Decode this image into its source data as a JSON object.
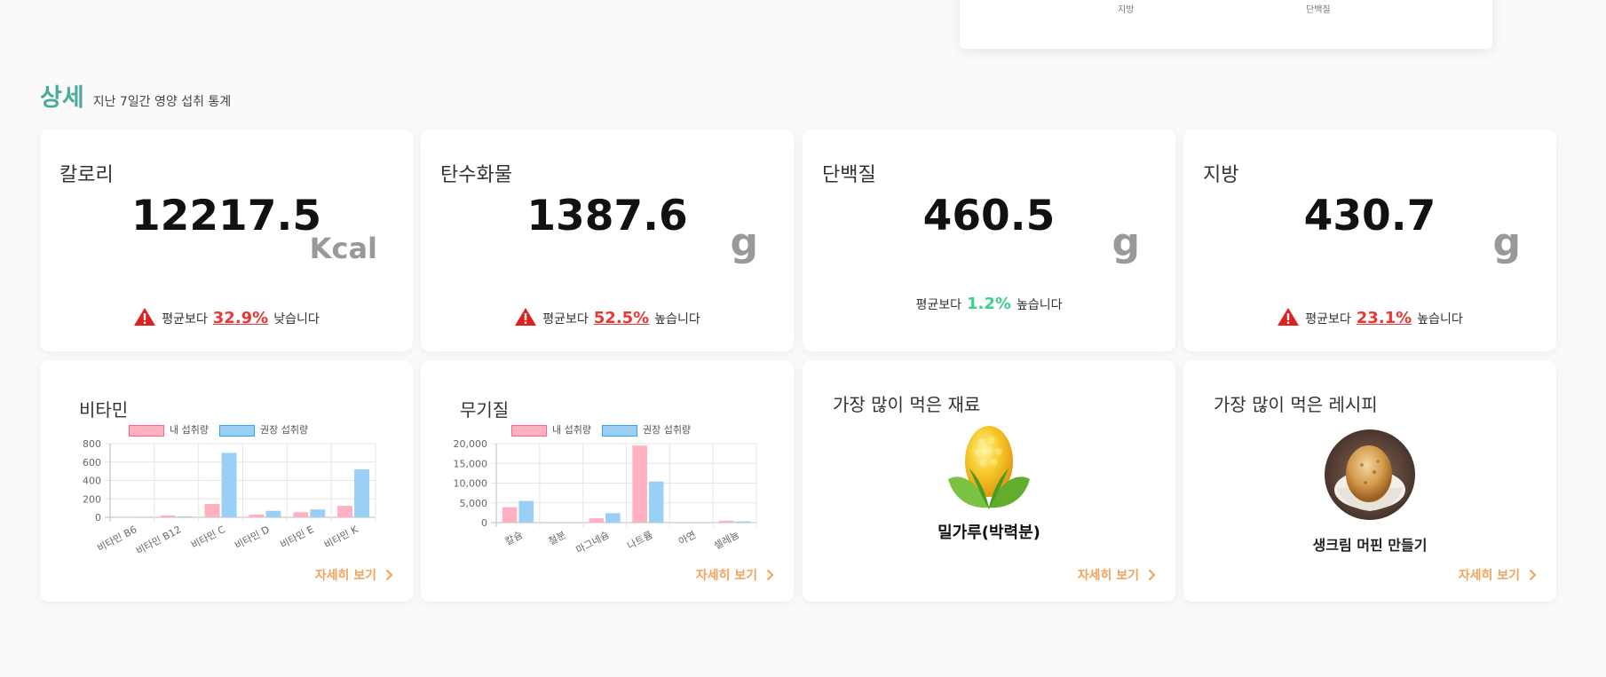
{
  "top_card": {
    "label_left": "지방",
    "label_right": "단백질"
  },
  "section": {
    "title": "상세",
    "subtitle": "지난 7일간 영양 섭취 통계"
  },
  "stats": [
    {
      "title": "칼로리",
      "value": "12217.5",
      "unit": "Kcal",
      "prefix": "평균보다",
      "percent": "32.9%",
      "suffix": "낮습니다",
      "status": "warning"
    },
    {
      "title": "탄수화물",
      "value": "1387.6",
      "unit": "g",
      "prefix": "평균보다",
      "percent": "52.5%",
      "suffix": "높습니다",
      "status": "warning"
    },
    {
      "title": "단백질",
      "value": "460.5",
      "unit": "g",
      "prefix": "평균보다",
      "percent": "1.2%",
      "suffix": "높습니다",
      "status": "ok"
    },
    {
      "title": "지방",
      "value": "430.7",
      "unit": "g",
      "prefix": "평균보다",
      "percent": "23.1%",
      "suffix": "높습니다",
      "status": "warning"
    }
  ],
  "vitamin_card": {
    "title": "비타민",
    "more": "자세히 보기"
  },
  "mineral_card": {
    "title": "무기질",
    "more": "자세히 보기"
  },
  "ingredient_card": {
    "title": "가장 많이 먹은 재료",
    "name": "밀가루(박력분)",
    "more": "자세히 보기"
  },
  "recipe_card": {
    "title": "가장 많이 먹은 레시피",
    "name": "생크림 머핀 만들기",
    "more": "자세히 보기"
  },
  "colors": {
    "accent": "#4aab9b",
    "mine": "#ffb1c1",
    "recommended": "#9ad0f5",
    "warning": "#e53935",
    "good": "#3ecf8e",
    "link": "#f6a15a"
  },
  "chart_data": [
    {
      "type": "bar",
      "title": "비타민",
      "categories": [
        "비타민 B6",
        "비타민 B12",
        "비타민 C",
        "비타민 D",
        "비타민 E",
        "비타민 K"
      ],
      "series": [
        {
          "name": "내 섭취량",
          "values": [
            3,
            20,
            145,
            30,
            55,
            125
          ]
        },
        {
          "name": "권장 섭취량",
          "values": [
            2,
            10,
            700,
            70,
            85,
            520
          ]
        }
      ],
      "yticks": [
        "0",
        "200",
        "400",
        "600",
        "800"
      ],
      "ylim": [
        0,
        800
      ],
      "legend": "top"
    },
    {
      "type": "bar",
      "title": "무기질",
      "categories": [
        "칼슘",
        "철분",
        "마그네슘",
        "나트륨",
        "아연",
        "셀레늄"
      ],
      "series": [
        {
          "name": "내 섭취량",
          "values": [
            3900,
            60,
            1100,
            19500,
            40,
            500
          ]
        },
        {
          "name": "권장 섭취량",
          "values": [
            5500,
            70,
            2400,
            10400,
            60,
            300
          ]
        }
      ],
      "yticks": [
        "0",
        "5,000",
        "10,000",
        "15,000",
        "20,000"
      ],
      "ylim": [
        0,
        20000
      ],
      "legend": "top"
    }
  ]
}
